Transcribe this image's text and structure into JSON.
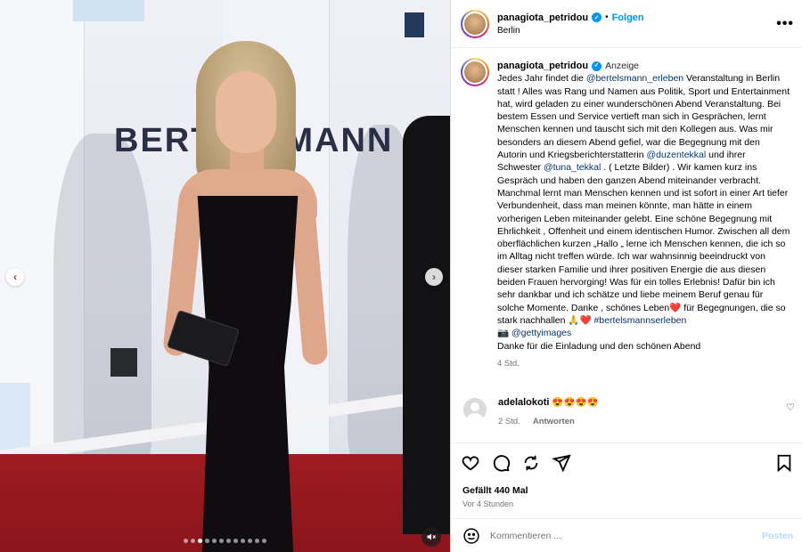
{
  "post": {
    "username": "panagiota_petridou",
    "follow_label": "Folgen",
    "separator": "•",
    "location": "Berlin",
    "more_label": "•••",
    "verified_mark": "✓",
    "photo_text": "BERTELSMANN",
    "media_prev": "‹",
    "media_next": "›",
    "carousel": {
      "total": 12,
      "active": 2
    }
  },
  "caption": {
    "username": "panagiota_petridou",
    "badge": "Anzeige",
    "p1": "Jedes Jahr findet die ",
    "m1": "@bertelsmann_erleben",
    "p2": " Veranstaltung in Berlin statt ! Alles was Rang und Namen aus Politik, Sport und Entertainment hat, wird geladen zu einer wunderschönen Abend Veranstaltung. Bei bestem Essen und Service vertieft man sich in Gesprächen, lernt Menschen kennen und tauscht sich mit den Kollegen aus. Was mir besonders an diesem Abend gefiel, war die Begegnung mit den Autorin und Kriegsberichterstatterin ",
    "m2": "@duzentekkal",
    "p3": " und ihrer Schwester ",
    "m3": "@tuna_tekkal",
    "p4": " . ( Letzte Bilder) . Wir kamen kurz ins Gespräch und haben den ganzen Abend miteinander verbracht. Manchmal lernt man Menschen kennen und ist sofort in einer Art tiefer Verbundenheit, dass man meinen könnte, man hätte in einem vorherigen Leben miteinander gelebt. Eine schöne Begegnung mit Ehrlichkeit , Offenheit und einem identischen Humor. Zwischen all dem oberflächlichen kurzen „Hallo „ lerne ich Menschen kennen, die ich so im Alltag nicht treffen würde. Ich war wahnsinnig beeindruckt von dieser starken Familie und ihrer positiven Energie die aus diesen beiden Frauen hervorging! Was für ein tolles Erlebnis! Dafür bin ich sehr dankbar und ich schätze und liebe meinem Beruf genau für solche Momente. Danke , schönes Leben❤️  für Begegnungen, die so stark nachhallen 🙏❤️ ",
    "m4": "#bertelsmannserleben",
    "p5": "\n📷 ",
    "m5": "@gettyimages",
    "p6": "\nDanke für die Einladung und den schönen Abend",
    "time": "4 Std."
  },
  "comment": {
    "username": "adelalokoti",
    "text": "😍😍😍😍",
    "time": "2 Std.",
    "reply_label": "Antworten",
    "like_icon": "♡"
  },
  "actions": {
    "likes": "Gefällt 440 Mal",
    "ago": "Vor 4 Stunden"
  },
  "compose": {
    "placeholder": "Kommentieren ...",
    "post_label": "Posten"
  },
  "colors": {
    "accent": "#0095f6",
    "post_disabled": "#b3dbff",
    "carpet": "#a01b22"
  }
}
